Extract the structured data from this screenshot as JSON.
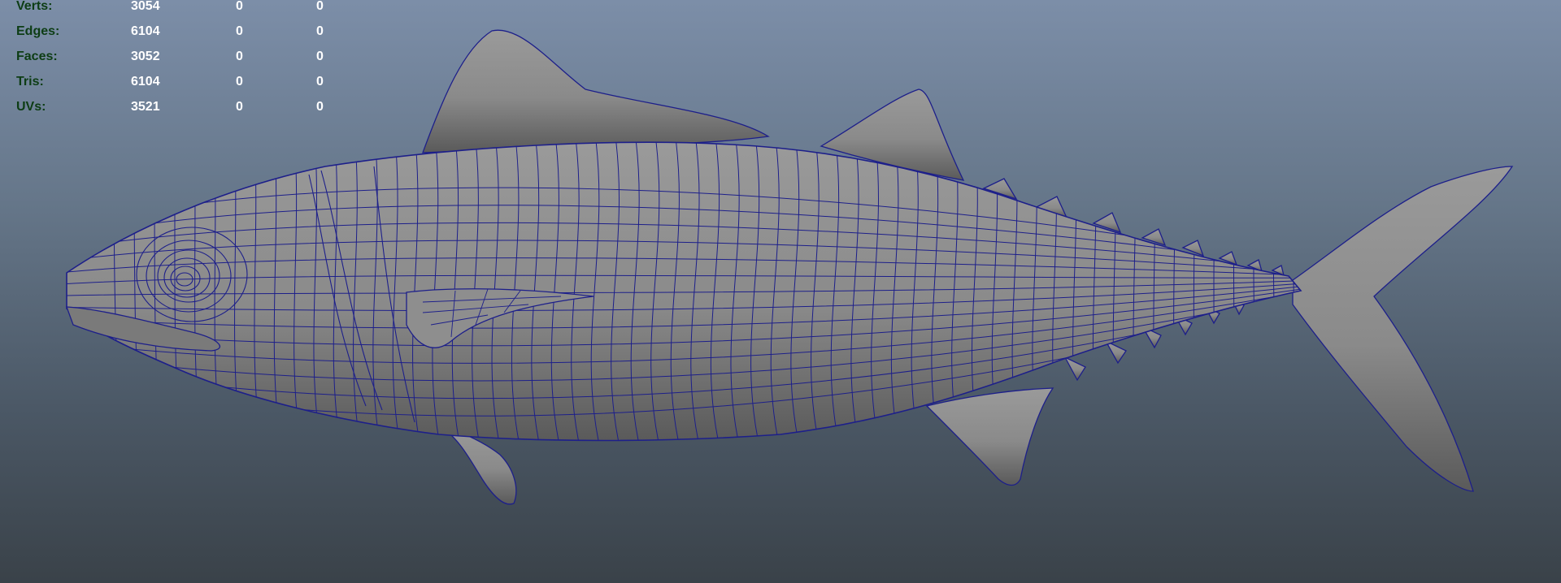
{
  "colors": {
    "bg_top": "#7c8ea8",
    "bg_bottom": "#3a4249",
    "hud_label": "#0d3d14",
    "hud_value": "#ffffff",
    "wireframe": "#1d1f8a",
    "mesh_fill": "#8a8a8a"
  },
  "hud": {
    "rows": [
      {
        "label": "Verts:",
        "total": "3054",
        "selected": "0",
        "component": "0"
      },
      {
        "label": "Edges:",
        "total": "6104",
        "selected": "0",
        "component": "0"
      },
      {
        "label": "Faces:",
        "total": "3052",
        "selected": "0",
        "component": "0"
      },
      {
        "label": "Tris:",
        "total": "6104",
        "selected": "0",
        "component": "0"
      },
      {
        "label": "UVs:",
        "total": "3521",
        "selected": "0",
        "component": "0"
      }
    ]
  },
  "viewport": {
    "model": "tuna-fish-wireframe-mesh",
    "display_mode": "wireframe-on-shaded"
  }
}
